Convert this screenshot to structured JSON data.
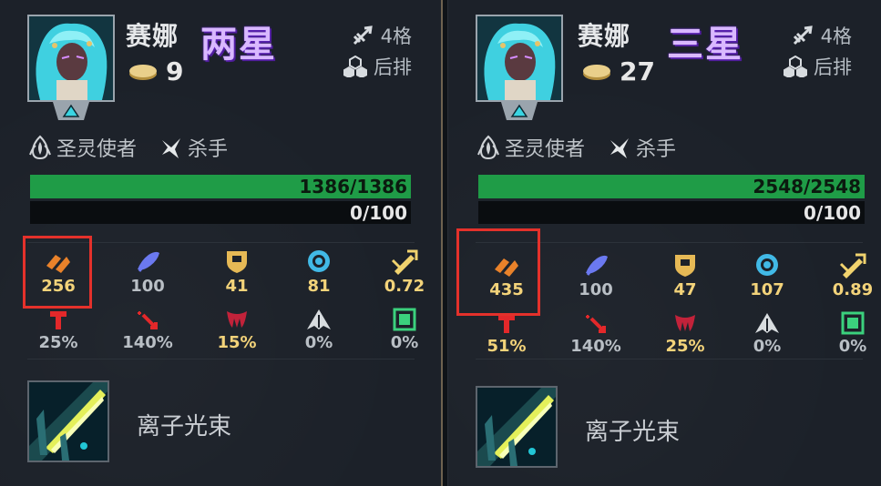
{
  "colors": {
    "hp": "#1f9c47",
    "highlight": "#e4312b",
    "stars_purple": "#d9b8ff",
    "gold_text": "#f3d37a"
  },
  "panels": [
    {
      "name": "赛娜",
      "stars": "两星",
      "cost": "9",
      "range": "4格",
      "position": "后排",
      "traits": [
        {
          "label": "圣灵使者",
          "icon": "spirit-icon"
        },
        {
          "label": "杀手",
          "icon": "assassin-icon"
        }
      ],
      "hp": "1386/1386",
      "hp_fraction": 1.0,
      "mana": "0/100",
      "stats_row1": [
        {
          "value": "256",
          "icon": "attack-damage-icon"
        },
        {
          "value": "100",
          "icon": "ability-power-icon"
        },
        {
          "value": "41",
          "icon": "armor-icon"
        },
        {
          "value": "81",
          "icon": "magic-resist-icon"
        },
        {
          "value": "0.72",
          "icon": "attack-speed-icon"
        }
      ],
      "stats_row2": [
        {
          "value": "25%",
          "icon": "crit-chance-icon"
        },
        {
          "value": "140%",
          "icon": "crit-damage-icon"
        },
        {
          "value": "15%",
          "icon": "omnivamp-icon"
        },
        {
          "value": "0%",
          "icon": "dodge-icon"
        },
        {
          "value": "0%",
          "icon": "damage-reduction-icon"
        }
      ],
      "item_name": "离子光束"
    },
    {
      "name": "赛娜",
      "stars": "三星",
      "cost": "27",
      "range": "4格",
      "position": "后排",
      "traits": [
        {
          "label": "圣灵使者",
          "icon": "spirit-icon"
        },
        {
          "label": "杀手",
          "icon": "assassin-icon"
        }
      ],
      "hp": "2548/2548",
      "hp_fraction": 1.0,
      "mana": "0/100",
      "stats_row1": [
        {
          "value": "435",
          "icon": "attack-damage-icon"
        },
        {
          "value": "100",
          "icon": "ability-power-icon"
        },
        {
          "value": "47",
          "icon": "armor-icon"
        },
        {
          "value": "107",
          "icon": "magic-resist-icon"
        },
        {
          "value": "0.89",
          "icon": "attack-speed-icon"
        }
      ],
      "stats_row2": [
        {
          "value": "51%",
          "icon": "crit-chance-icon"
        },
        {
          "value": "140%",
          "icon": "crit-damage-icon"
        },
        {
          "value": "25%",
          "icon": "omnivamp-icon"
        },
        {
          "value": "0%",
          "icon": "dodge-icon"
        },
        {
          "value": "0%",
          "icon": "damage-reduction-icon"
        }
      ],
      "item_name": "离子光束"
    }
  ]
}
